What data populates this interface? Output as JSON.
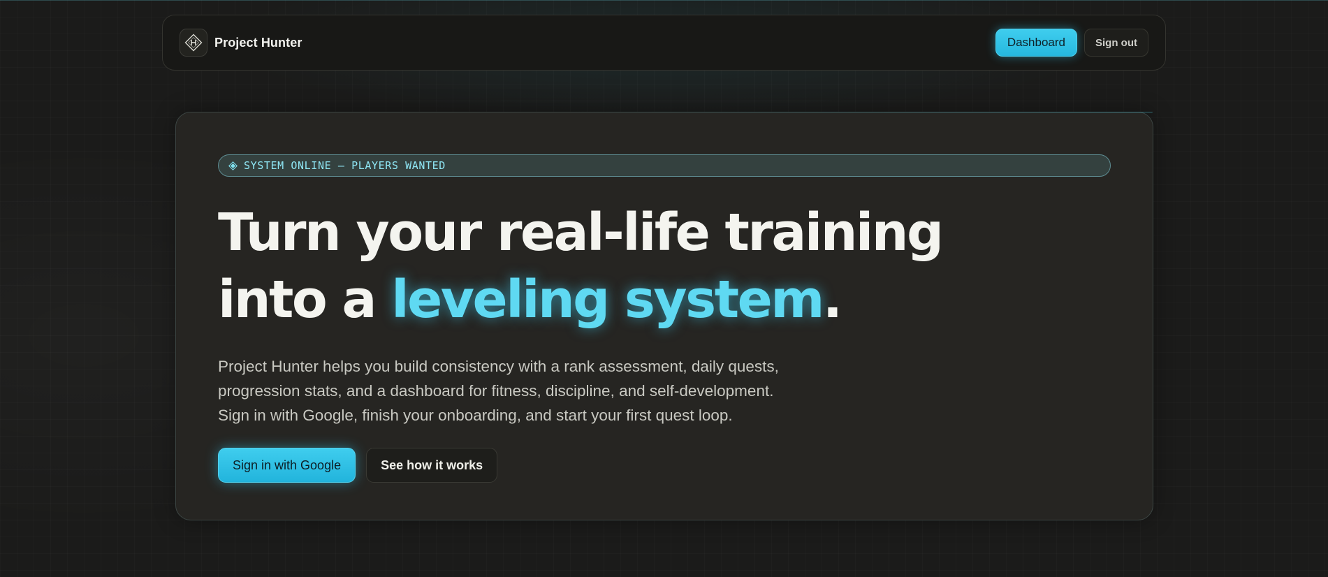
{
  "colors": {
    "accent": "#3fcdee",
    "accent_text": "#5fd9f2",
    "background": "#1b1b1a",
    "card": "#262522"
  },
  "navbar": {
    "logo_icon": "diamond-h-logo-icon",
    "brand_name": "Project Hunter",
    "dashboard_label": "Dashboard",
    "signout_label": "Sign out"
  },
  "hero": {
    "status_icon": "diamond-icon",
    "status_text": "SYSTEM ONLINE — PLAYERS WANTED",
    "headline_line1": "Turn your real-life training",
    "headline_line2_prefix": "into a ",
    "headline_line2_accent": "leveling system",
    "headline_line2_suffix": ".",
    "description_line1": "Project Hunter helps you build consistency with a rank assessment, daily quests,",
    "description_line2": "progression stats, and a dashboard for fitness, discipline, and self-development.",
    "description_line3": "Sign in with Google, finish your onboarding, and start your first quest loop.",
    "primary_cta": "Sign in with Google",
    "secondary_cta": "See how it works"
  }
}
